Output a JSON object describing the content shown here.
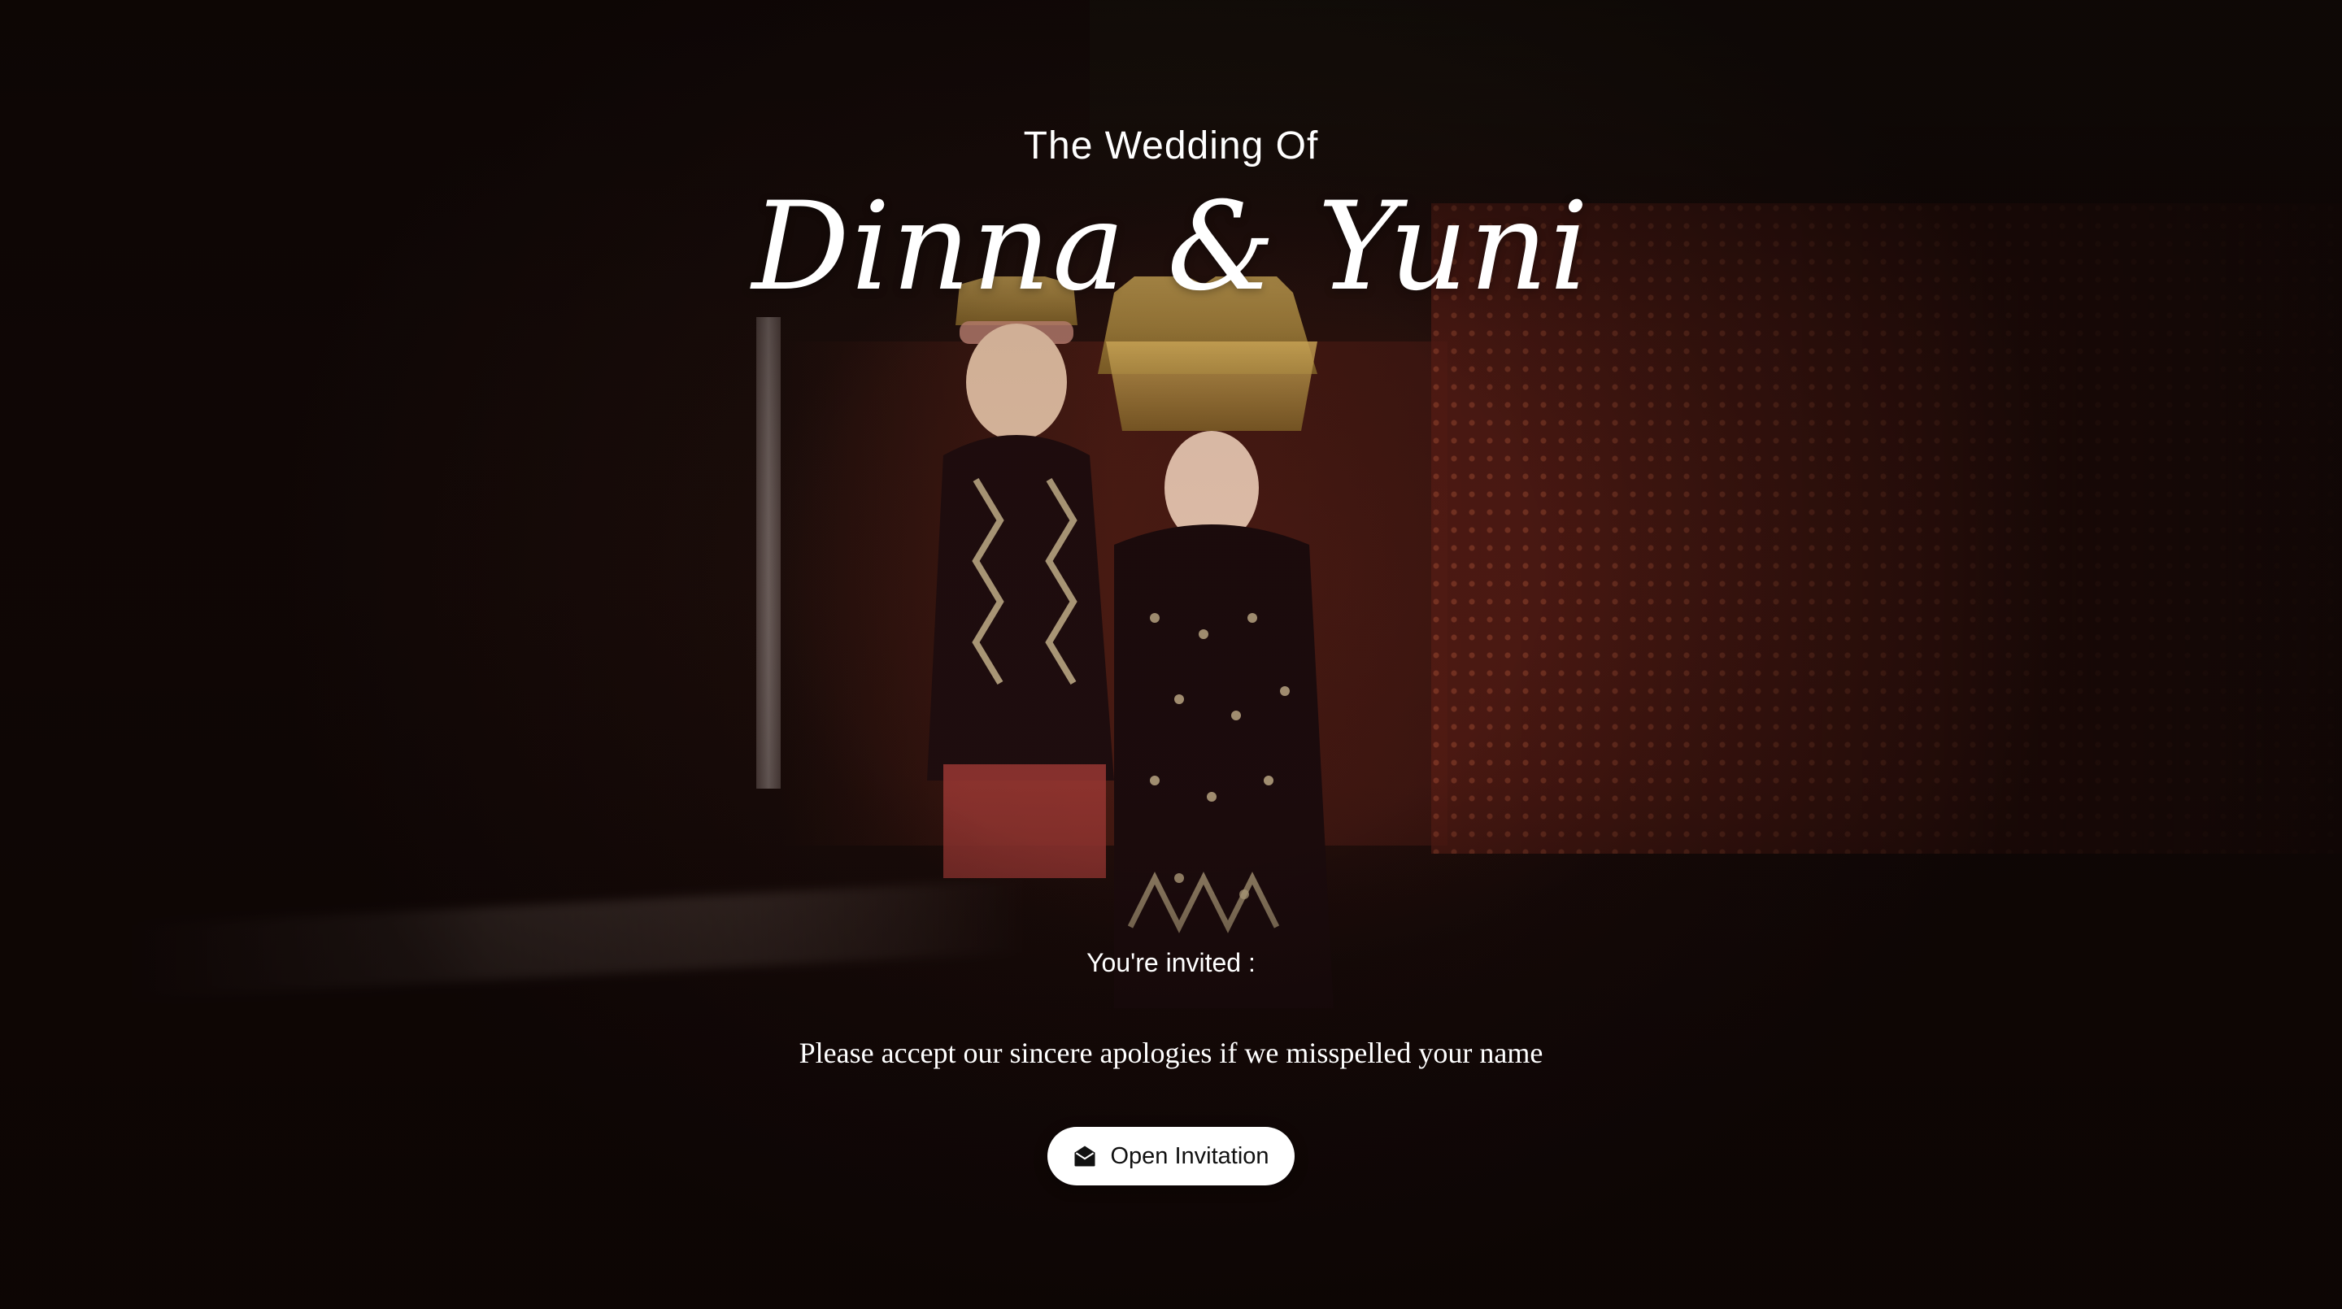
{
  "hero": {
    "pre_title": "The Wedding Of",
    "couple_names": "Dinna & Yuni",
    "background_image": "wedding-couple-traditional-attire-photo"
  },
  "invitation": {
    "invited_label": "You're invited :",
    "guest_name": "",
    "apology_text": "Please accept our sincere apologies if we misspelled your name",
    "open_button_label": "Open Invitation",
    "open_button_icon": "envelope-open-icon"
  },
  "colors": {
    "text": "#ffffff",
    "button_bg": "#ffffff",
    "button_text": "#111111",
    "background": "#150907",
    "wall_accent": "#5a1d15"
  }
}
